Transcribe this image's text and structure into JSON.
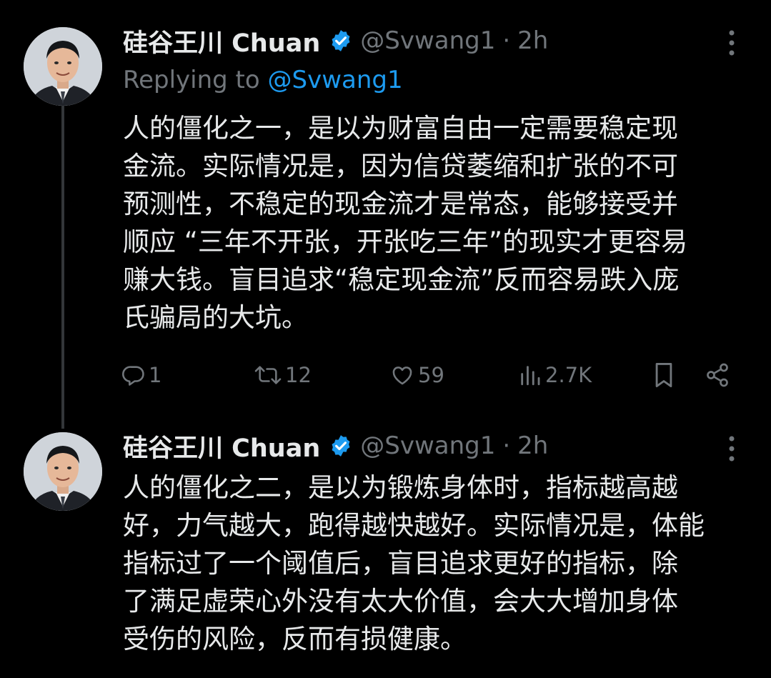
{
  "tweets": [
    {
      "author_name": "硅谷王川 Chuan",
      "handle": "@Svwang1",
      "separator": "·",
      "time": "2h",
      "replying_label": "Replying to",
      "replying_handle": "@Svwang1",
      "lines": [
        "人的僵化之一，是以为财富自由一定需要稳定现",
        "金流。实际情况是，因为信贷萎缩和扩张的不可",
        "预测性，不稳定的现金流才是常态，能够接受并",
        "顺应 “三年不开张，开张吃三年”的现实才更容易",
        "赚大钱。盲目追求“稳定现金流”反而容易跌入庞",
        "氏骗局的大坑。"
      ],
      "actions": {
        "replies": "1",
        "retweets": "12",
        "likes": "59",
        "views": "2.7K"
      }
    },
    {
      "author_name": "硅谷王川 Chuan",
      "handle": "@Svwang1",
      "separator": "·",
      "time": "2h",
      "lines": [
        "人的僵化之二，是以为锻炼身体时，指标越高越",
        "好，力气越大，跑得越快越好。实际情况是，体能",
        "指标过了一个阈值后，盲目追求更好的指标，除",
        "了满足虚荣心外没有太大价值，会大大增加身体",
        "受伤的风险，反而有损健康。"
      ]
    }
  ],
  "colors": {
    "background": "#000000",
    "text": "#e7e9ea",
    "muted": "#71767b",
    "accent": "#1d9bf0"
  },
  "icons": [
    "verified-badge-icon",
    "more-icon",
    "reply-icon",
    "retweet-icon",
    "like-icon",
    "views-icon",
    "bookmark-icon",
    "share-icon"
  ]
}
